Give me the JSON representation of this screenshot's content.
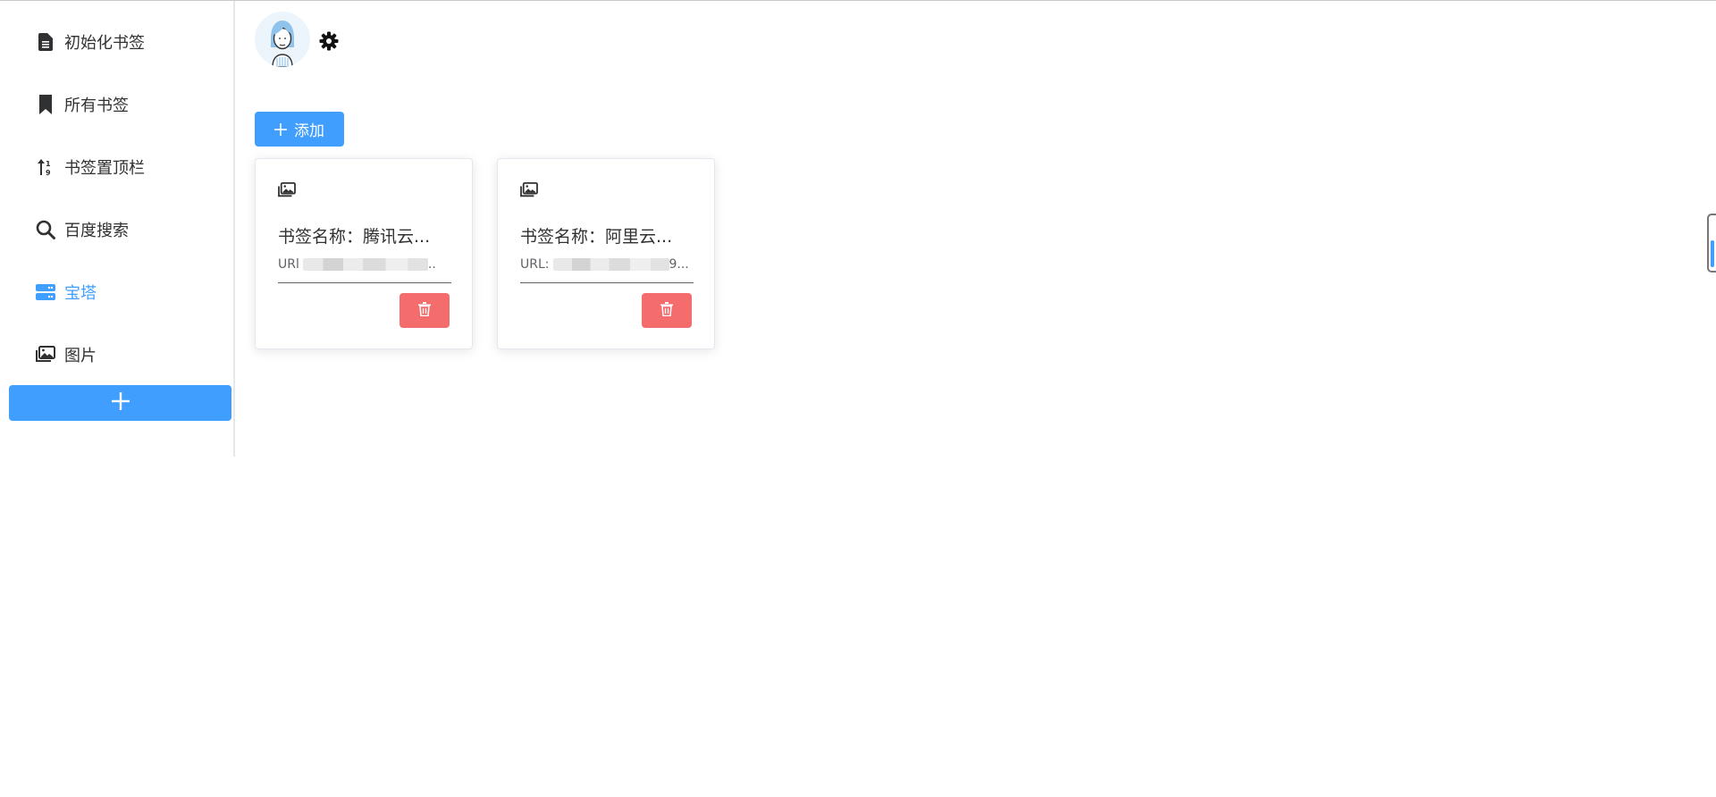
{
  "sidebar": {
    "items": [
      {
        "label": "初始化书签",
        "icon": "file-text-icon"
      },
      {
        "label": "所有书签",
        "icon": "bookmark-icon"
      },
      {
        "label": "书签置顶栏",
        "icon": "sort-arrows-icon"
      },
      {
        "label": "百度搜索",
        "icon": "search-icon"
      },
      {
        "label": "宝塔",
        "icon": "server-icon",
        "active": true
      },
      {
        "label": "图片",
        "icon": "images-icon"
      }
    ],
    "add_icon": "plus-icon"
  },
  "header": {
    "avatar_icon": "user-avatar",
    "settings_icon": "gear-icon"
  },
  "toolbar": {
    "add_label": "添加"
  },
  "cards": [
    {
      "name": "书签名称：腾讯云...",
      "url_prefix": "URl",
      "url_suffix": "..",
      "icon": "images-icon",
      "delete_icon": "trash-icon"
    },
    {
      "name": "书签名称：阿里云...",
      "url_prefix": "URL:",
      "url_suffix": "9...",
      "icon": "images-icon",
      "delete_icon": "trash-icon"
    }
  ],
  "colors": {
    "primary": "#409eff",
    "danger": "#f56c6c",
    "text": "#303133"
  }
}
